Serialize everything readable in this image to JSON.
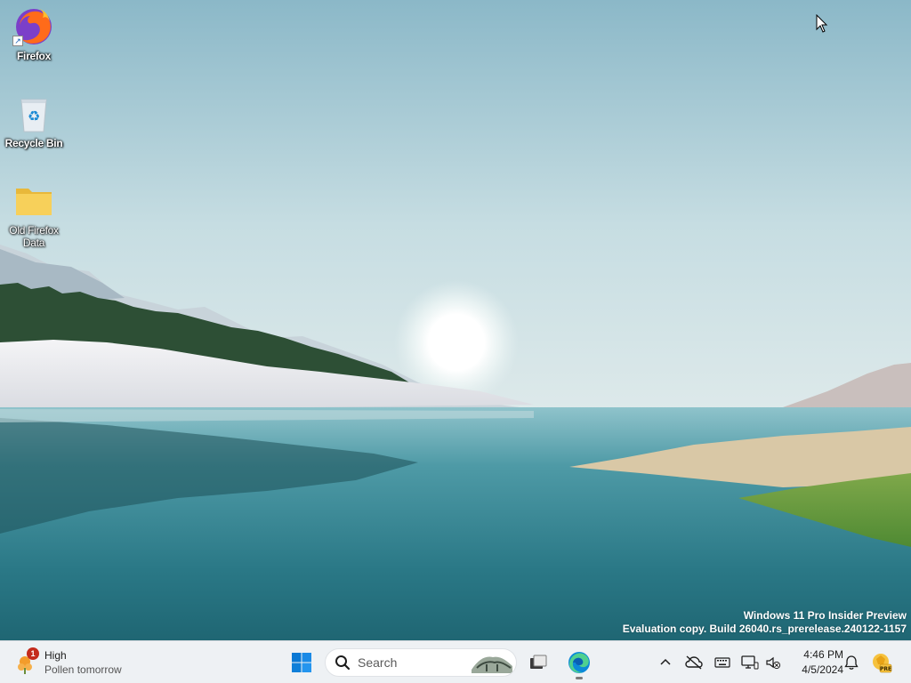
{
  "desktop": {
    "icons": [
      {
        "label": "Firefox",
        "icon": "firefox-icon"
      },
      {
        "label": "Recycle Bin",
        "icon": "recycle-bin-icon"
      },
      {
        "label": "Old Firefox Data",
        "icon": "folder-icon"
      }
    ],
    "watermark": {
      "line1": "Windows 11 Pro Insider Preview",
      "line2": "Evaluation copy. Build 26040.rs_prerelease.240122-1157"
    }
  },
  "taskbar": {
    "weather": {
      "badge": "1",
      "title": "High",
      "subtitle": "Pollen tomorrow"
    },
    "search": {
      "placeholder": "Search"
    },
    "pinned": [
      "start-icon",
      "task-view-icon",
      "edge-icon"
    ],
    "tray": [
      "chevron-up-icon",
      "onedrive-icon",
      "keyboard-icon",
      "network-icon",
      "volume-muted-icon"
    ],
    "clock": {
      "time": "4:46 PM",
      "date": "4/5/2024"
    },
    "notification_badge": "PRE"
  },
  "colors": {
    "sky_top": "#86b4c6",
    "water": "#2f7f8e",
    "taskbar": "#eef1f4",
    "start_blue": "#0a78d4"
  }
}
